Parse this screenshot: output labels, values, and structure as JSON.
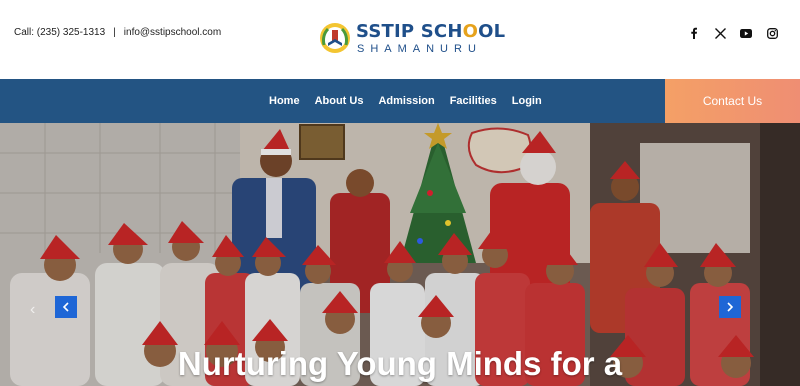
{
  "header": {
    "phone": "Call: (235) 325-1313",
    "separator": "|",
    "email": "info@sstipschool.com",
    "logo_title_a": "SSTIP SCH",
    "logo_title_o": "O",
    "logo_title_b": "OL",
    "logo_subtitle": "SHAMANURU",
    "social_icons": [
      "facebook-icon",
      "x-icon",
      "youtube-icon",
      "instagram-icon"
    ]
  },
  "nav": {
    "items": [
      {
        "label": "Home"
      },
      {
        "label": "About Us"
      },
      {
        "label": "Admission"
      },
      {
        "label": "Facilities"
      },
      {
        "label": "Login"
      }
    ],
    "cta_label": "Contact Us"
  },
  "hero": {
    "heading": "Nurturing Young Minds for a",
    "prev_symbol": "‹",
    "next_symbol": "›",
    "ghost_arrow": "‹"
  },
  "colors": {
    "nav_bg": "#235483",
    "cta_gradient_start": "#f4a066",
    "cta_gradient_end": "#ef8e73",
    "arrow_bg": "#1e66d6",
    "logo_blue": "#1f4f8a"
  }
}
